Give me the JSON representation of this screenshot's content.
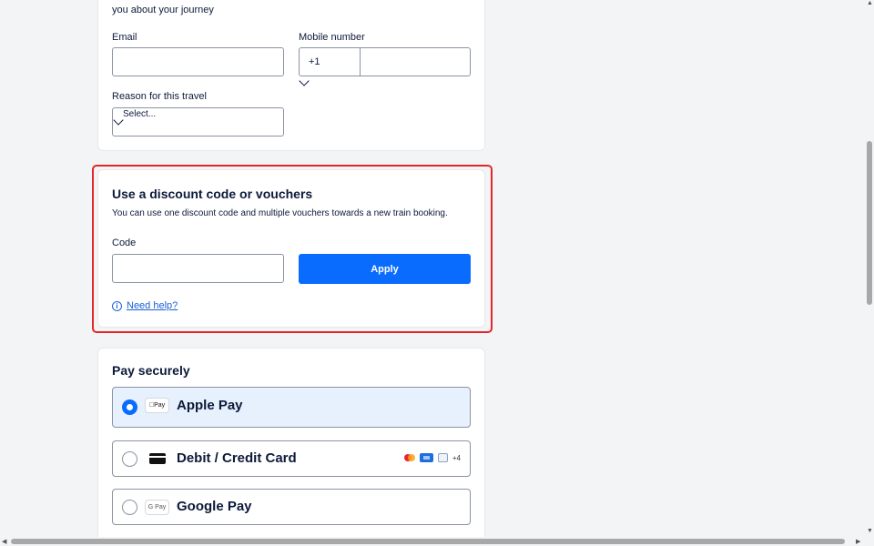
{
  "contact": {
    "intro_text": "you about your journey",
    "email_label": "Email",
    "email_value": "",
    "mobile_label": "Mobile number",
    "country_code": "+1",
    "mobile_value": "",
    "reason_label": "Reason for this travel",
    "reason_selected": "Select..."
  },
  "discount": {
    "title": "Use a discount code or vouchers",
    "description": "You can use one discount code and multiple vouchers towards a new train booking.",
    "code_label": "Code",
    "code_value": "",
    "apply_label": "Apply",
    "help_icon": "info-icon",
    "help_label": "Need help?",
    "highlight_color": "#e4262b"
  },
  "payment": {
    "title": "Pay securely",
    "options": [
      {
        "badge": "Pay",
        "label": "Apple Pay",
        "selected": true
      },
      {
        "badge": "card-icon",
        "label": "Debit / Credit Card",
        "selected": false,
        "extra_count": "+4"
      },
      {
        "badge": "G Pay",
        "label": "Google Pay",
        "selected": false
      }
    ]
  },
  "colors": {
    "accent": "#0a6cff",
    "text": "#0c1a3a",
    "link": "#1a5fd6",
    "selected_bg": "#e7f0fd"
  }
}
